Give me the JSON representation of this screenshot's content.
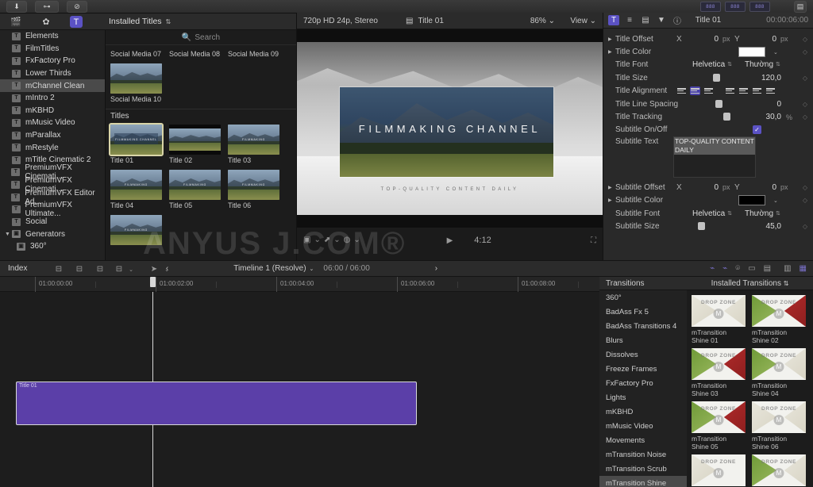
{
  "topbar": {
    "buttons": [
      {
        "name": "download-button",
        "glyph": "⬇"
      },
      {
        "name": "keychain-button",
        "glyph": "⊶"
      },
      {
        "name": "check-button",
        "glyph": "⊘"
      }
    ],
    "right_meters": [
      "888",
      "888",
      "888"
    ],
    "right_icon": "▤"
  },
  "toolbar": {
    "icons": [
      {
        "name": "media-import-icon",
        "glyph": "🎬"
      },
      {
        "name": "effects-icon",
        "glyph": "✿"
      },
      {
        "name": "titles-icon",
        "glyph": "T"
      }
    ],
    "browser_menu": "Installed Titles",
    "browser_menu_caret": "⇅"
  },
  "sidebar": {
    "items": [
      {
        "label": "Elements",
        "icon": "T",
        "selected": false,
        "kind": "title"
      },
      {
        "label": "FilmTitles",
        "icon": "T",
        "selected": false,
        "kind": "title"
      },
      {
        "label": "FxFactory Pro",
        "icon": "T",
        "selected": false,
        "kind": "title"
      },
      {
        "label": "Lower Thirds",
        "icon": "T",
        "selected": false,
        "kind": "title"
      },
      {
        "label": "mChannel Clean",
        "icon": "T",
        "selected": true,
        "kind": "title"
      },
      {
        "label": "mIntro 2",
        "icon": "T",
        "selected": false,
        "kind": "title"
      },
      {
        "label": "mKBHD",
        "icon": "T",
        "selected": false,
        "kind": "title"
      },
      {
        "label": "mMusic Video",
        "icon": "T",
        "selected": false,
        "kind": "title"
      },
      {
        "label": "mParallax",
        "icon": "T",
        "selected": false,
        "kind": "title"
      },
      {
        "label": "mRestyle",
        "icon": "T",
        "selected": false,
        "kind": "title"
      },
      {
        "label": "mTitle Cinematic 2",
        "icon": "T",
        "selected": false,
        "kind": "title"
      },
      {
        "label": "PremiumVFX Cinemati...",
        "icon": "T",
        "selected": false,
        "kind": "title"
      },
      {
        "label": "PremiumVFX Cinemati...",
        "icon": "T",
        "selected": false,
        "kind": "title"
      },
      {
        "label": "PremiumVFX Editor Ad...",
        "icon": "T",
        "selected": false,
        "kind": "title"
      },
      {
        "label": "PremiumVFX Ultimate...",
        "icon": "T",
        "selected": false,
        "kind": "title"
      },
      {
        "label": "Social",
        "icon": "T",
        "selected": false,
        "kind": "title"
      },
      {
        "label": "Generators",
        "icon": "▣",
        "selected": false,
        "kind": "group"
      },
      {
        "label": "360°",
        "icon": "▣",
        "selected": false,
        "kind": "gen"
      }
    ]
  },
  "browser": {
    "search_placeholder": "Search",
    "top_row_captions": [
      "Social Media 07",
      "Social Media 08",
      "Social Media 09"
    ],
    "social_last_caption": "Social Media 10",
    "section_title": "Titles",
    "titles": [
      {
        "caption": "Title 01",
        "selected": true,
        "style": "overlay"
      },
      {
        "caption": "Title 02",
        "selected": false,
        "style": "letterbox"
      },
      {
        "caption": "Title 03",
        "selected": false,
        "style": "plain"
      },
      {
        "caption": "Title 04",
        "selected": false,
        "style": "plain"
      },
      {
        "caption": "Title 05",
        "selected": false,
        "style": "plain"
      },
      {
        "caption": "Title 06",
        "selected": false,
        "style": "plain"
      }
    ],
    "partial_caption": ""
  },
  "viewer": {
    "format": "720p HD 24p, Stereo",
    "clip_name": "Title 01",
    "clip_icon": "▤",
    "zoom": "86%",
    "zoom_caret": "⌄",
    "view_label": "View",
    "view_caret": "⌄",
    "canvas_title": "FILMMAKING CHANNEL",
    "canvas_subtitle": "TOP-QUALITY CONTENT DAILY",
    "timecode": "4:12",
    "watermark": "ANYUS J.COM®"
  },
  "inspector": {
    "tabs": [
      {
        "name": "text-inspector-tab",
        "glyph": "T",
        "active": true
      },
      {
        "name": "video-inspector-tab",
        "glyph": "≡",
        "active": false
      },
      {
        "name": "generator-inspector-tab",
        "glyph": "▤",
        "active": false
      },
      {
        "name": "color-inspector-tab",
        "glyph": "▼",
        "active": false
      },
      {
        "name": "info-inspector-tab",
        "glyph": "ⓘ",
        "active": false
      }
    ],
    "title": "Title 01",
    "duration": "00:00:06:00",
    "params": [
      {
        "label": "Title Offset",
        "type": "xy",
        "x": "0",
        "y": "0",
        "unit": "px"
      },
      {
        "label": "Title Color",
        "type": "color",
        "value": "#ffffff"
      },
      {
        "label": "Title Font",
        "type": "font",
        "family": "Helvetica",
        "style": "Thường"
      },
      {
        "label": "Title Size",
        "type": "slider",
        "value": "120,0",
        "knob": 0.38
      },
      {
        "label": "Title Alignment",
        "type": "align",
        "active": 1
      },
      {
        "label": "Title Line Spacing",
        "type": "slider",
        "value": "0",
        "knob": 0.42
      },
      {
        "label": "Title Tracking",
        "type": "slider",
        "value": "30,0",
        "unit": "%",
        "knob": 0.56
      },
      {
        "label": "Subtitle On/Off",
        "type": "check",
        "checked": true
      },
      {
        "label": "Subtitle Text",
        "type": "textarea",
        "value": "TOP-QUALITY CONTENT DAILY"
      },
      {
        "label": "Subtitle Offset",
        "type": "xy",
        "x": "0",
        "y": "0",
        "unit": "px"
      },
      {
        "label": "Subtitle Color",
        "type": "color",
        "value": "#000000"
      },
      {
        "label": "Subtitle Font",
        "type": "font",
        "family": "Helvetica",
        "style": "Thường"
      },
      {
        "label": "Subtitle Size",
        "type": "slider",
        "value": "45,0",
        "knob": 0.1
      }
    ]
  },
  "timeline_toolbar": {
    "index_label": "Index",
    "tools": [
      "⊟",
      "⊟",
      "⊟",
      "⊟"
    ],
    "tools_caret": "⌄",
    "pointer": "➤",
    "pointer_caret": "⌄",
    "prev": "‹",
    "next": "›",
    "project_name": "Timeline 1 (Resolve)",
    "project_caret": "⌄",
    "timecode": "06:00 / 06:00",
    "right_icons": [
      "⌁",
      "⌁",
      "🎧",
      "▭",
      "▤",
      "▥",
      "▦"
    ]
  },
  "timeline": {
    "ticks": [
      {
        "label": "01:00:00:00",
        "pos": 44
      },
      {
        "label": "01:00:02:00",
        "pos": 196
      },
      {
        "label": "01:00:04:00",
        "pos": 348
      },
      {
        "label": "01:00:06:00",
        "pos": 500
      },
      {
        "label": "01:00:08:00",
        "pos": 652
      }
    ],
    "minor_ticks": [
      120,
      272,
      424,
      576,
      728
    ],
    "playhead": 192,
    "clip": {
      "name": "Title 01",
      "color": "#5b3fa8"
    }
  },
  "transitions": {
    "header_left": "Transitions",
    "header_right": "Installed Transitions",
    "header_caret": "⇅",
    "categories": [
      {
        "label": "360°",
        "selected": false
      },
      {
        "label": "BadAss Fx 5",
        "selected": false
      },
      {
        "label": "BadAss Transitions 4",
        "selected": false
      },
      {
        "label": "Blurs",
        "selected": false
      },
      {
        "label": "Dissolves",
        "selected": false
      },
      {
        "label": "Freeze Frames",
        "selected": false
      },
      {
        "label": "FxFactory Pro",
        "selected": false
      },
      {
        "label": "Lights",
        "selected": false
      },
      {
        "label": "mKBHD",
        "selected": false
      },
      {
        "label": "mMusic Video",
        "selected": false
      },
      {
        "label": "Movements",
        "selected": false
      },
      {
        "label": "mTransition Noise",
        "selected": false
      },
      {
        "label": "mTransition Scrub",
        "selected": false
      },
      {
        "label": "mTransition Shine",
        "selected": true
      }
    ],
    "drop_zone_label": "DROP ZONE",
    "items": [
      {
        "caption": "mTransition Shine 01",
        "left": "pale",
        "right": "pale"
      },
      {
        "caption": "mTransition Shine 02",
        "left": "green",
        "right": "red"
      },
      {
        "caption": "mTransition Shine 03",
        "left": "green",
        "right": "red"
      },
      {
        "caption": "mTransition Shine 04",
        "left": "green",
        "right": "pale"
      },
      {
        "caption": "mTransition Shine 05",
        "left": "green",
        "right": "red"
      },
      {
        "caption": "mTransition Shine 06",
        "left": "pale",
        "right": "pale"
      },
      {
        "caption": "",
        "left": "pale",
        "right": "none"
      },
      {
        "caption": "",
        "left": "green",
        "right": "pale"
      }
    ]
  }
}
